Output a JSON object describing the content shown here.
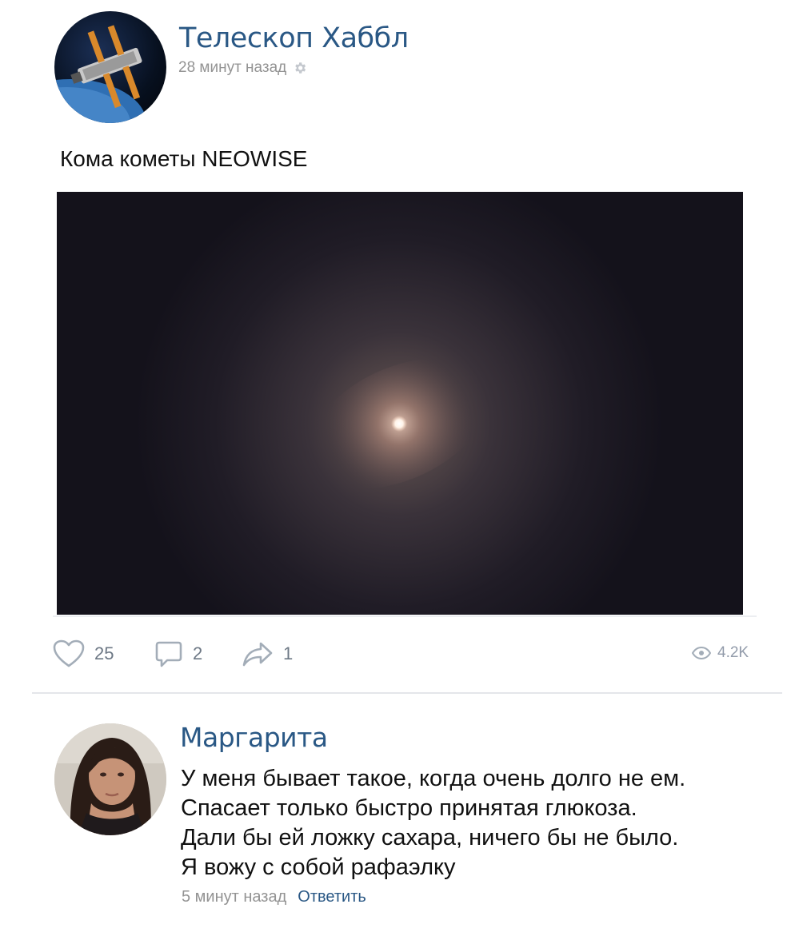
{
  "post": {
    "author": "Телескоп Хаббл",
    "time": "28 минут назад",
    "avatar_icon": "hubble-telescope-avatar",
    "settings_icon": "gear-icon",
    "text": "Кома кометы NEOWISE",
    "image_icon": "comet-neowise-photo",
    "actions": {
      "likes": "25",
      "comments": "2",
      "shares": "1",
      "views": "4.2K"
    },
    "icons": [
      "heart-icon",
      "comment-icon",
      "share-icon",
      "eye-icon"
    ]
  },
  "comment": {
    "author": "Маргарита",
    "avatar_icon": "user-avatar-photo",
    "lines": [
      "У меня бывает такое, когда очень долго не ем.",
      "Спасает только быстро принятая глюкоза.",
      "Дали бы ей ложку сахара, ничего бы не было.",
      "Я вожу с собой рафаэлку"
    ],
    "time": "5 минут назад",
    "reply": "Ответить"
  },
  "colors": {
    "link": "#2a5885",
    "meta": "#939393",
    "action": "#6d7885",
    "image_bg": "#14121b"
  }
}
